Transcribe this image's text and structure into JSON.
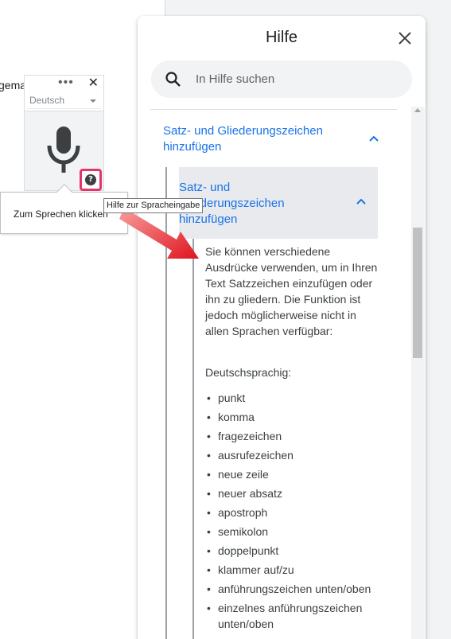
{
  "doc": {
    "partial_text": "gema"
  },
  "voice_widget": {
    "menu_dots": "•••",
    "close_glyph": "✕",
    "language": "Deutsch",
    "help_glyph": "?",
    "speak_tooltip": "Zum Sprechen klicken",
    "hover_tooltip": "Hilfe zur Spracheingabe"
  },
  "help_panel": {
    "title": "Hilfe",
    "search_placeholder": "In Hilfe suchen",
    "section_title": "Satz- und Gliederungszeichen hinzufügen",
    "subsection_title": "Satz- und Gliederungszeichen hinzufügen",
    "body": "Sie können verschiedene Ausdrücke verwenden, um in Ihren Text Satzzeichen einzufügen oder ihn zu gliedern. Die Funktion ist jedoch möglicherweise nicht in allen Sprachen verfügbar:",
    "language_heading": "Deutschsprachig:",
    "commands": [
      "punkt",
      "komma",
      "fragezeichen",
      "ausrufezeichen",
      "neue zeile",
      "neuer absatz",
      "apostroph",
      "semikolon",
      "doppelpunkt",
      "klammer auf/zu",
      "anführungszeichen unten/oben",
      "einzelnes anführungszeichen unten/oben"
    ]
  },
  "colors": {
    "link_blue": "#1a73e8",
    "highlight_pink": "#e8336d",
    "arrow_red": "#e0141e"
  },
  "icons": {
    "mic": "microphone-icon",
    "help": "help-circle-icon",
    "search": "search-icon",
    "close": "close-icon",
    "chevron": "chevron-up-icon"
  }
}
